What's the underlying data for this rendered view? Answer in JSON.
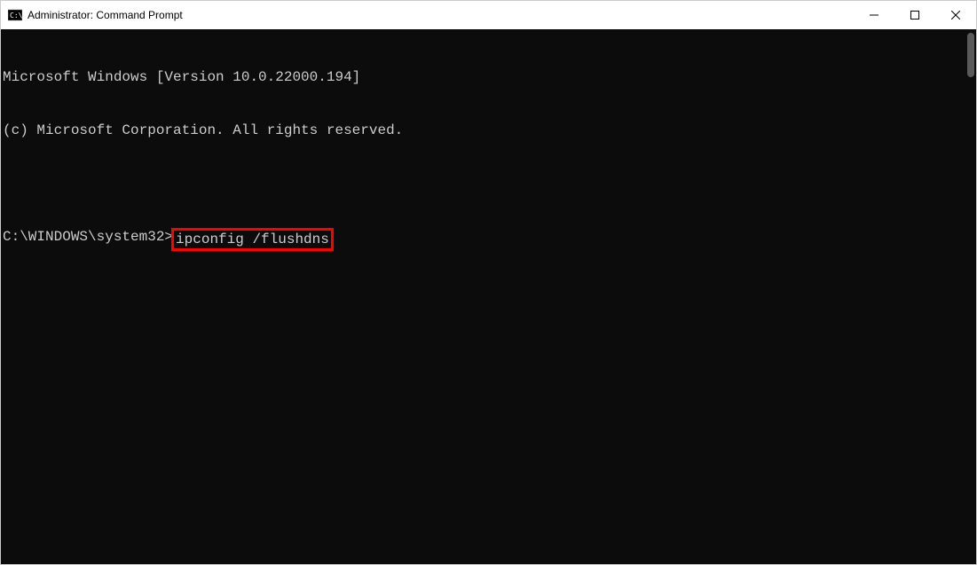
{
  "window": {
    "title": "Administrator: Command Prompt"
  },
  "terminal": {
    "line1": "Microsoft Windows [Version 10.0.22000.194]",
    "line2": "(c) Microsoft Corporation. All rights reserved.",
    "prompt": "C:\\WINDOWS\\system32>",
    "command": "ipconfig /flushdns"
  },
  "colors": {
    "highlight": "#ff0000",
    "terminal_bg": "#0c0c0c",
    "terminal_fg": "#cccccc"
  }
}
